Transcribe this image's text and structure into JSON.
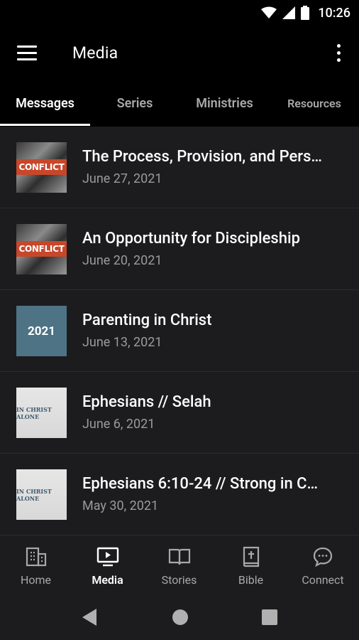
{
  "status_bar": {
    "time": "10:26"
  },
  "app_bar": {
    "title": "Media"
  },
  "tabs": [
    {
      "label": "Messages",
      "active": true
    },
    {
      "label": "Series",
      "active": false
    },
    {
      "label": "Ministries",
      "active": false
    },
    {
      "label": "Resources",
      "active": false
    }
  ],
  "messages": [
    {
      "title": "The Process, Provision, and Pers…",
      "date": "June 27, 2021",
      "thumb_text": "CONFLICT"
    },
    {
      "title": "An Opportunity for Discipleship",
      "date": "June 20, 2021",
      "thumb_text": "CONFLICT"
    },
    {
      "title": "Parenting in Christ",
      "date": "June 13, 2021",
      "thumb_text": "2021"
    },
    {
      "title": "Ephesians // Selah",
      "date": "June 6, 2021",
      "thumb_text": "IN CHRIST ALONE"
    },
    {
      "title": "Ephesians 6:10-24 // Strong in C…",
      "date": "May 30, 2021",
      "thumb_text": "IN CHRIST ALONE"
    }
  ],
  "bottom_nav": [
    {
      "label": "Home",
      "icon": "building-icon",
      "active": false
    },
    {
      "label": "Media",
      "icon": "tv-play-icon",
      "active": true
    },
    {
      "label": "Stories",
      "icon": "open-book-icon",
      "active": false
    },
    {
      "label": "Bible",
      "icon": "bible-icon",
      "active": false
    },
    {
      "label": "Connect",
      "icon": "chat-bubble-icon",
      "active": false
    }
  ],
  "colors": {
    "background": "#1c1c1e",
    "header": "#000000",
    "conflict_band": "#c8472a",
    "thumb_2021": "#4d7385",
    "inactive_text": "#a8a8a8",
    "date_text": "#9a9a9a"
  }
}
